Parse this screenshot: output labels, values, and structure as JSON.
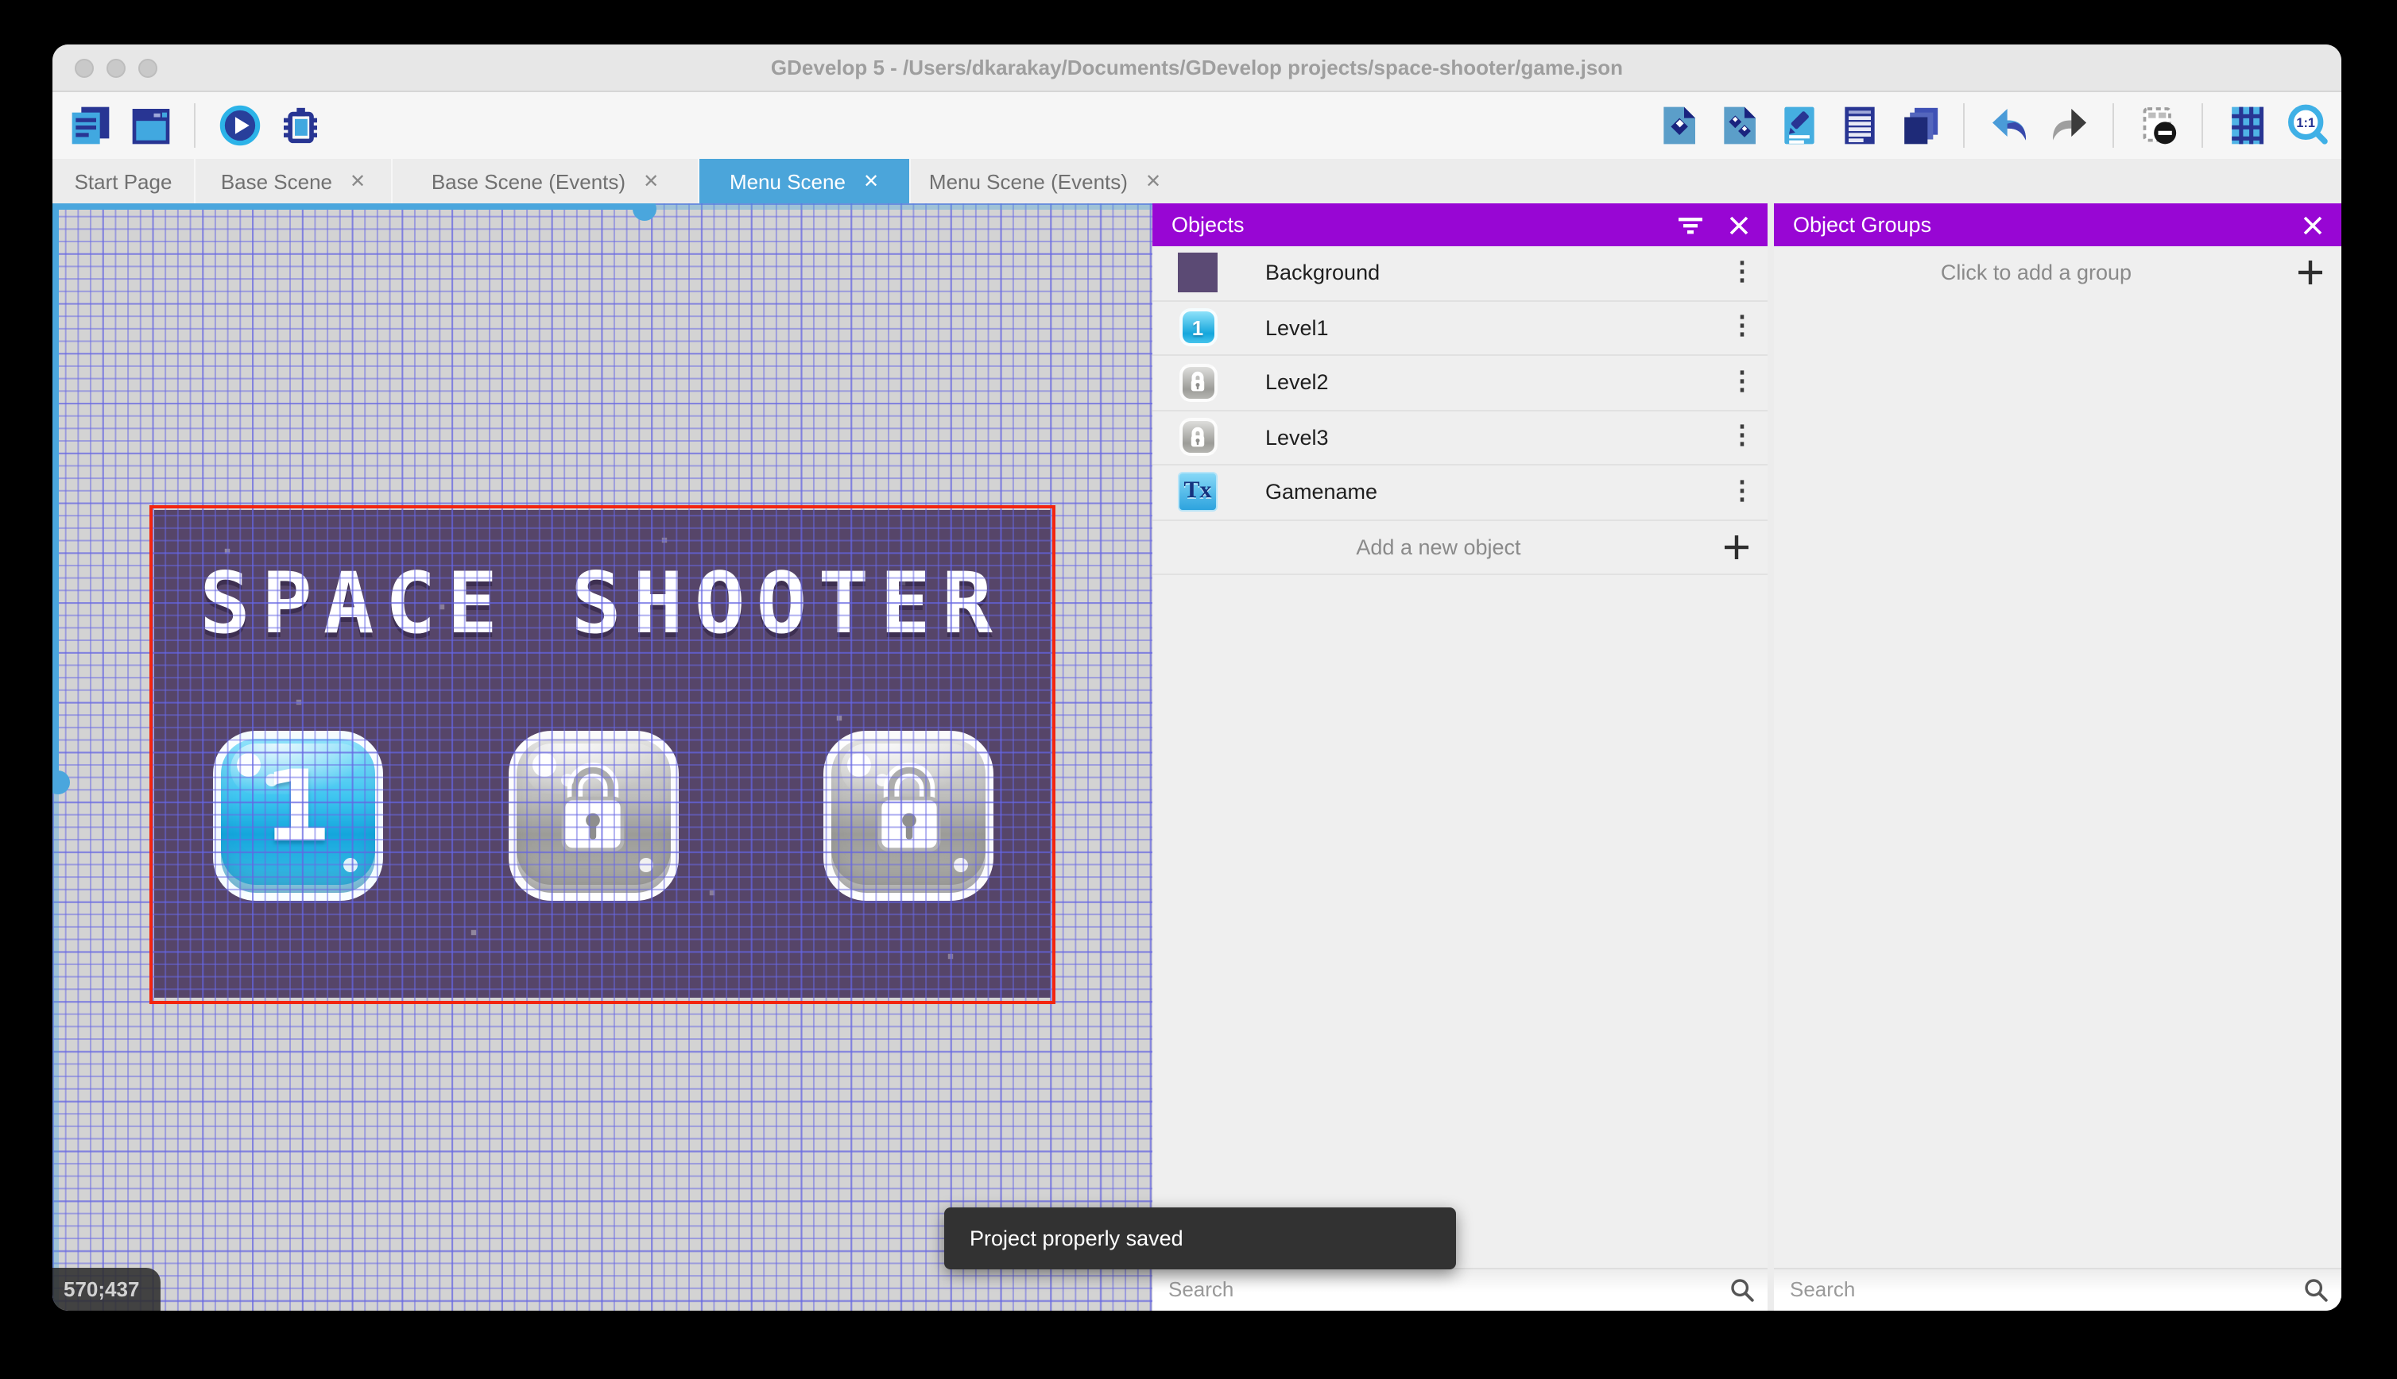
{
  "window": {
    "title": "GDevelop 5 - /Users/dkarakay/Documents/GDevelop projects/space-shooter/game.json",
    "controls": [
      "close",
      "minimize",
      "fullscreen"
    ]
  },
  "toolbar": {
    "left_icons": [
      "project-manager",
      "start-page-window",
      "play",
      "debug"
    ],
    "right_icons": [
      "objects-editor",
      "object-groups-editor",
      "properties",
      "instances-list",
      "layers",
      "undo",
      "redo",
      "window-mask",
      "grid",
      "zoom-original"
    ]
  },
  "tabs": [
    {
      "label": "Start Page",
      "closable": false,
      "active": false
    },
    {
      "label": "Base Scene",
      "closable": true,
      "active": false
    },
    {
      "label": "Base Scene (Events)",
      "closable": true,
      "active": false
    },
    {
      "label": "Menu Scene",
      "closable": true,
      "active": true
    },
    {
      "label": "Menu Scene (Events)",
      "closable": true,
      "active": false
    }
  ],
  "canvas": {
    "coordinates": "570;437",
    "scene": {
      "title_text": "SPACE SHOOTER",
      "level1_label": "1",
      "buttons": [
        "level-1-unlocked",
        "level-2-locked",
        "level-3-locked"
      ]
    }
  },
  "objects_panel": {
    "title": "Objects",
    "items": [
      {
        "name": "Background",
        "icon": "background-thumbnail"
      },
      {
        "name": "Level1",
        "icon": "blue-button-thumbnail",
        "icon_label": "1"
      },
      {
        "name": "Level2",
        "icon": "locked-button-thumbnail"
      },
      {
        "name": "Level3",
        "icon": "locked-button-thumbnail"
      },
      {
        "name": "Gamename",
        "icon": "text-object-thumbnail",
        "icon_label": "Tx"
      }
    ],
    "add_label": "Add a new object",
    "search_placeholder": "Search"
  },
  "groups_panel": {
    "title": "Object Groups",
    "add_label": "Click to add a group",
    "search_placeholder": "Search"
  },
  "toast": {
    "message": "Project properly saved"
  },
  "colors": {
    "panel_header": "#9806d4",
    "active_tab": "#4ba5da",
    "scrollbar": "#4aa6dd",
    "scene_border": "#f3250f",
    "scene_background": "#564569",
    "canvas_background": "#d3d3d3",
    "toast_background": "#323232"
  }
}
